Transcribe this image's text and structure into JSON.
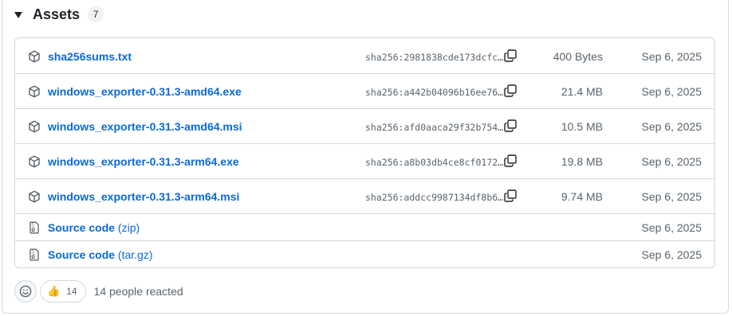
{
  "assets": {
    "title": "Assets",
    "count": "7",
    "rows": [
      {
        "name": "sha256sums.txt",
        "sha": "sha256:2981838cde173dcfc…",
        "size": "400 Bytes",
        "date": "Sep 6, 2025"
      },
      {
        "name": "windows_exporter-0.31.3-amd64.exe",
        "sha": "sha256:a442b04096b16ee76…",
        "size": "21.4 MB",
        "date": "Sep 6, 2025"
      },
      {
        "name": "windows_exporter-0.31.3-amd64.msi",
        "sha": "sha256:afd0aaca29f32b754…",
        "size": "10.5 MB",
        "date": "Sep 6, 2025"
      },
      {
        "name": "windows_exporter-0.31.3-arm64.exe",
        "sha": "sha256:a8b03db4ce8cf0172…",
        "size": "19.8 MB",
        "date": "Sep 6, 2025"
      },
      {
        "name": "windows_exporter-0.31.3-arm64.msi",
        "sha": "sha256:addcc9987134df8b6…",
        "size": "9.74 MB",
        "date": "Sep 6, 2025"
      }
    ],
    "source": [
      {
        "label": "Source code",
        "suffix": "(zip)",
        "date": "Sep 6, 2025"
      },
      {
        "label": "Source code",
        "suffix": "(tar.gz)",
        "date": "Sep 6, 2025"
      }
    ]
  },
  "reactions": {
    "emoji": "👍",
    "count": "14",
    "text": "14 people reacted"
  },
  "icons": {
    "package": "package-icon",
    "file_zip": "file-zip-icon",
    "copy": "copy-icon",
    "smiley": "smiley-icon",
    "caret": "triangle-down-icon"
  },
  "colors": {
    "link": "#0969da",
    "muted": "#59636e",
    "border": "#d1d9e0"
  }
}
